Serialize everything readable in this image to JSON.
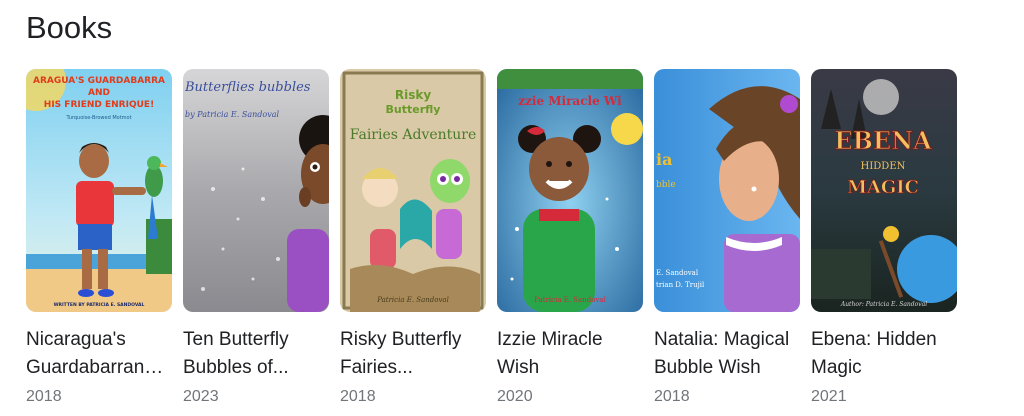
{
  "section": {
    "title": "Books"
  },
  "books": [
    {
      "title": "Nicaragua's Guardabarranco...",
      "year": "2018",
      "cover_text": [
        "ARAGUA'S GUARDABARRA",
        "AND",
        "HIS FRIEND ENRIQUE!",
        "Turquoise-Browed Motmot",
        "WRITTEN BY PATRICIA E. SANDOVAL"
      ]
    },
    {
      "title": "Ten Butterfly Bubbles of...",
      "year": "2023",
      "cover_text": [
        "Butterflies bubbles",
        "by Patricia E. Sandoval"
      ]
    },
    {
      "title": "Risky Butterfly Fairies...",
      "year": "2018",
      "cover_text": [
        "Risky",
        "Butterfly",
        "Fairies Adventure",
        "Patricia E. Sandoval"
      ]
    },
    {
      "title": "Izzie Miracle Wish",
      "year": "2020",
      "cover_text": [
        "zzie Miracle Wi",
        "Patricia E. Sandoval"
      ]
    },
    {
      "title": "Natalia: Magical Bubble Wish",
      "year": "2018",
      "cover_text": [
        "ia",
        "bble",
        "E. Sandoval",
        "trian D. Trujil"
      ]
    },
    {
      "title": "Ebena: Hidden Magic",
      "year": "2021",
      "cover_text": [
        "EBENA",
        "HIDDEN",
        "MAGIC",
        "Author: Patricia E. Sandoval"
      ]
    }
  ]
}
